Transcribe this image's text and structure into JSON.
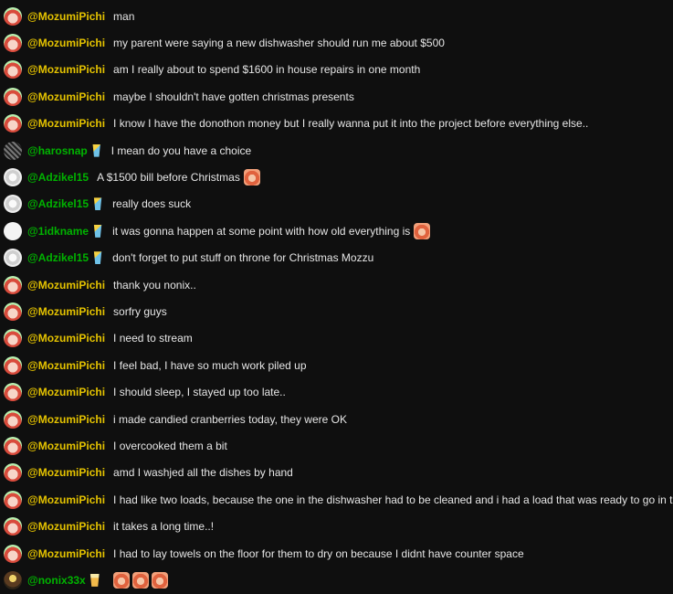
{
  "colors": {
    "background": "#0f0f0f",
    "message_text": "#e6e6e6",
    "user_mozumi": "#e5c300",
    "user_green": "#00b300"
  },
  "messages": [
    {
      "user": "@MozumiPichi",
      "avatar": "mozumi",
      "color": "#e5c300",
      "badge": "",
      "text": "man",
      "emotes": 0
    },
    {
      "user": "@MozumiPichi",
      "avatar": "mozumi",
      "color": "#e5c300",
      "badge": "",
      "text": "my parent were saying a new dishwasher should run me about $500",
      "emotes": 0
    },
    {
      "user": "@MozumiPichi",
      "avatar": "mozumi",
      "color": "#e5c300",
      "badge": "",
      "text": "am I really about to spend $1600 in house repairs in one month",
      "emotes": 0
    },
    {
      "user": "@MozumiPichi",
      "avatar": "mozumi",
      "color": "#e5c300",
      "badge": "",
      "text": "maybe I shouldn't have gotten christmas presents",
      "emotes": 0
    },
    {
      "user": "@MozumiPichi",
      "avatar": "mozumi",
      "color": "#e5c300",
      "badge": "",
      "text": "I know I have the donothon money but I really wanna put it into the project before everything else..",
      "emotes": 0
    },
    {
      "user": "@harosnap",
      "avatar": "haro",
      "color": "#00b300",
      "badge": "drink",
      "text": "I mean do you have a choice",
      "emotes": 0
    },
    {
      "user": "@Adzikel15",
      "avatar": "adzi",
      "color": "#00b300",
      "badge": "",
      "text": "A $1500 bill before Christmas",
      "emotes": 1
    },
    {
      "user": "@Adzikel15",
      "avatar": "adzi",
      "color": "#00b300",
      "badge": "drink",
      "text": "really does suck",
      "emotes": 0
    },
    {
      "user": "@1idkname",
      "avatar": "idk",
      "color": "#00b300",
      "badge": "drink",
      "text": "it was gonna happen at some point with how old everything is",
      "emotes": 1
    },
    {
      "user": "@Adzikel15",
      "avatar": "adzi",
      "color": "#00b300",
      "badge": "drink",
      "text": "don't forget to put stuff on throne for Christmas Mozzu",
      "emotes": 0
    },
    {
      "user": "@MozumiPichi",
      "avatar": "mozumi",
      "color": "#e5c300",
      "badge": "",
      "text": "thank you nonix..",
      "emotes": 0
    },
    {
      "user": "@MozumiPichi",
      "avatar": "mozumi",
      "color": "#e5c300",
      "badge": "",
      "text": "sorfry guys",
      "emotes": 0
    },
    {
      "user": "@MozumiPichi",
      "avatar": "mozumi",
      "color": "#e5c300",
      "badge": "",
      "text": "I need to stream",
      "emotes": 0
    },
    {
      "user": "@MozumiPichi",
      "avatar": "mozumi",
      "color": "#e5c300",
      "badge": "",
      "text": "I feel bad, I have so much work piled up",
      "emotes": 0
    },
    {
      "user": "@MozumiPichi",
      "avatar": "mozumi",
      "color": "#e5c300",
      "badge": "",
      "text": "I should sleep, I stayed up too late..",
      "emotes": 0
    },
    {
      "user": "@MozumiPichi",
      "avatar": "mozumi",
      "color": "#e5c300",
      "badge": "",
      "text": "i made candied cranberries today, they were OK",
      "emotes": 0
    },
    {
      "user": "@MozumiPichi",
      "avatar": "mozumi",
      "color": "#e5c300",
      "badge": "",
      "text": "I overcooked them a bit",
      "emotes": 0
    },
    {
      "user": "@MozumiPichi",
      "avatar": "mozumi",
      "color": "#e5c300",
      "badge": "",
      "text": "amd I washjed all the dishes by hand",
      "emotes": 0
    },
    {
      "user": "@MozumiPichi",
      "avatar": "mozumi",
      "color": "#e5c300",
      "badge": "",
      "text": "I had like two loads, because the one in the dishwasher had to be cleaned and i had a load that was ready to go in too",
      "emotes": 0
    },
    {
      "user": "@MozumiPichi",
      "avatar": "mozumi",
      "color": "#e5c300",
      "badge": "",
      "text": "it takes a long time..!",
      "emotes": 0
    },
    {
      "user": "@MozumiPichi",
      "avatar": "mozumi",
      "color": "#e5c300",
      "badge": "",
      "text": "I had to lay towels on the floor for them to dry on because I didnt have counter space",
      "emotes": 0
    },
    {
      "user": "@nonix33x",
      "avatar": "nonix",
      "color": "#00b300",
      "badge": "cup",
      "text": "",
      "emotes": 3
    }
  ]
}
